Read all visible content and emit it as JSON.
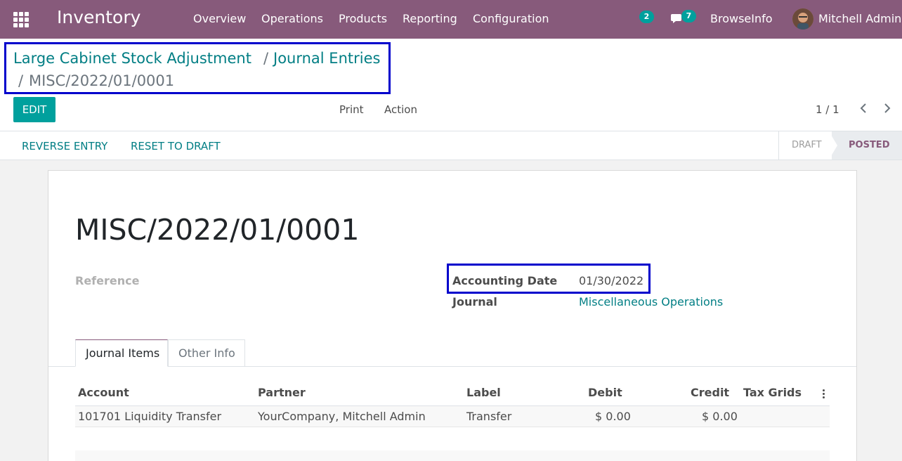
{
  "navbar": {
    "app_name": "Inventory",
    "menu": [
      "Overview",
      "Operations",
      "Products",
      "Reporting",
      "Configuration"
    ],
    "activity_count": "2",
    "message_count": "7",
    "company": "BrowseInfo",
    "user": "Mitchell Admin"
  },
  "breadcrumb": {
    "first": "Large Cabinet Stock Adjustment",
    "second": "Journal Entries",
    "separator": "/",
    "current": "MISC/2022/01/0001"
  },
  "control_panel": {
    "edit_label": "EDIT",
    "print_label": "Print",
    "action_label": "Action",
    "pager": "1 / 1"
  },
  "statusbar": {
    "reverse_label": "REVERSE ENTRY",
    "reset_label": "RESET TO DRAFT",
    "stage_draft": "DRAFT",
    "stage_posted": "POSTED"
  },
  "form": {
    "name": "MISC/2022/01/0001",
    "reference_label": "Reference",
    "accounting_date_label": "Accounting Date",
    "accounting_date": "01/30/2022",
    "journal_label": "Journal",
    "journal": "Miscellaneous Operations"
  },
  "tabs": [
    "Journal Items",
    "Other Info"
  ],
  "table": {
    "columns": [
      "Account",
      "Partner",
      "Label",
      "Debit",
      "Credit",
      "Tax Grids"
    ],
    "rows": [
      [
        "101701 Liquidity Transfer",
        "YourCompany, Mitchell Admin",
        "Transfer",
        "$ 0.00",
        "$ 0.00",
        ""
      ]
    ]
  },
  "colors": {
    "brand": "#875a7b",
    "accent": "#00a09d",
    "link": "#017e84",
    "highlight_box": "#0000cc"
  }
}
